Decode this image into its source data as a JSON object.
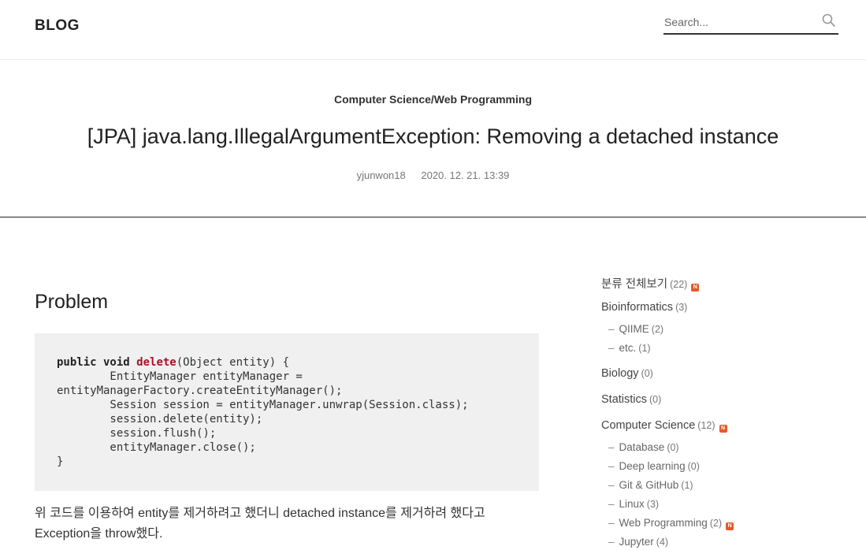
{
  "header": {
    "logo": "BLOG",
    "search_placeholder": "Search..."
  },
  "post": {
    "category": "Computer Science/Web Programming",
    "title": "[JPA] java.lang.IllegalArgumentException: Removing a detached instance",
    "author": "yjunwon18",
    "date": "2020. 12. 21. 13:39"
  },
  "content": {
    "heading": "Problem",
    "code": {
      "kw": "public void ",
      "fn": "delete",
      "rest": "(Object entity) {\n        EntityManager entityManager =\nentityManagerFactory.createEntityManager();\n        Session session = entityManager.unwrap(Session.class);\n        session.delete(entity);\n        session.flush();\n        entityManager.close();\n}"
    },
    "paragraph_line1": "위 코드를 이용하여 entity를 제거하려고 했더니 detached instance를 제거하려 했다고",
    "paragraph_line2": "Exception을 throw했다."
  },
  "sidebar": {
    "categories": [
      {
        "label": "분류 전체보기",
        "count": "(22)",
        "new": true
      },
      {
        "label": "Bioinformatics",
        "count": "(3)"
      },
      {
        "label": "QIIME",
        "count": "(2)"
      },
      {
        "label": "etc.",
        "count": "(1)"
      },
      {
        "label": "Biology",
        "count": "(0)"
      },
      {
        "label": "Statistics",
        "count": "(0)"
      },
      {
        "label": "Computer Science",
        "count": "(12)",
        "new": true
      },
      {
        "label": "Database",
        "count": "(0)"
      },
      {
        "label": "Deep learning",
        "count": "(0)"
      },
      {
        "label": "Git & GitHub",
        "count": "(1)"
      },
      {
        "label": "Linux",
        "count": "(3)"
      },
      {
        "label": "Web Programming",
        "count": "(2)",
        "new": true
      },
      {
        "label": "Jupyter",
        "count": "(4)"
      }
    ],
    "new_badge": "N",
    "sub_dash": "–"
  },
  "colors": {
    "accent_new": "#e35a2c",
    "code_function": "#a3152b",
    "code_background": "#f0f0f0"
  },
  "icons": {
    "search": "search-icon"
  }
}
